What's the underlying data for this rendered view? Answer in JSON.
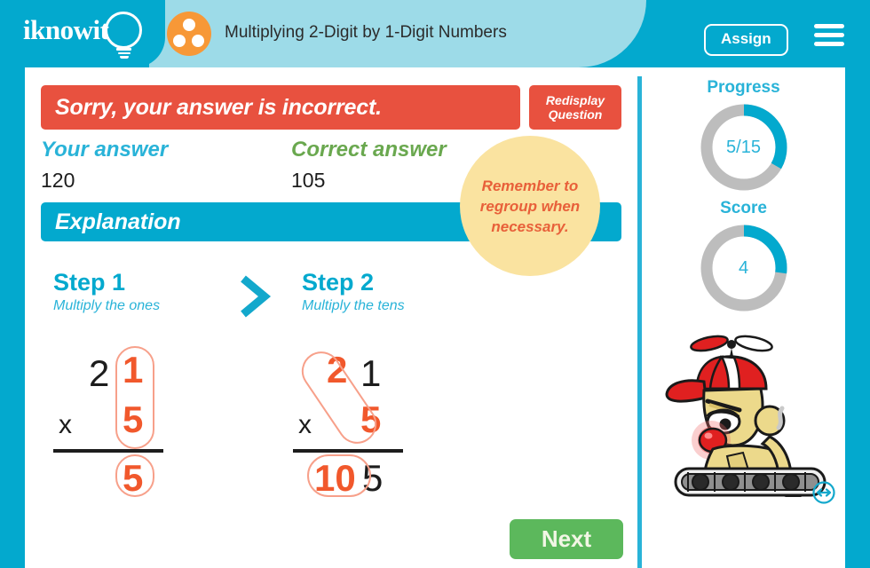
{
  "header": {
    "logo_text": "iknowit",
    "logo_icon": "lightbulb-icon",
    "topic_icon": "three-dots-circle-icon",
    "topic_title": "Multiplying 2-Digit by 1-Digit Numbers",
    "assign_label": "Assign",
    "menu_icon": "hamburger-menu-icon"
  },
  "feedback": {
    "banner_text": "Sorry, your answer is incorrect.",
    "redisplay_line1": "Redisplay",
    "redisplay_line2": "Question",
    "your_answer_label": "Your answer",
    "your_answer_value": "120",
    "correct_answer_label": "Correct answer",
    "correct_answer_value": "105"
  },
  "explanation": {
    "heading": "Explanation",
    "chevron_icon": "chevron-right-icon",
    "steps": [
      {
        "title": "Step 1",
        "subtitle": "Multiply the ones"
      },
      {
        "title": "Step 2",
        "subtitle": "Multiply the tens"
      }
    ],
    "work_step1": {
      "top_tens": "2",
      "top_ones": "1",
      "operator": "x",
      "multiplier": "5",
      "product_ones": "5"
    },
    "work_step2": {
      "top_tens": "2",
      "top_ones": "1",
      "operator": "x",
      "multiplier": "5",
      "product_tens": "10",
      "product_ones": "5"
    },
    "note": "Remember to regroup when necessary."
  },
  "actions": {
    "next_label": "Next"
  },
  "sidebar": {
    "progress_label": "Progress",
    "progress_value": "5/15",
    "score_label": "Score",
    "score_value": "4",
    "mascot_icon": "robot-mascot-icon",
    "resize_icon": "resize-arrows-icon"
  },
  "chart_data": [
    {
      "type": "pie",
      "title": "Progress",
      "categories": [
        "completed",
        "remaining"
      ],
      "values": [
        5,
        10
      ],
      "value_label": "5/15",
      "colors": [
        "#03a9ce",
        "#bdbdbd"
      ]
    },
    {
      "type": "pie",
      "title": "Score",
      "categories": [
        "earned",
        "remaining"
      ],
      "values": [
        27,
        73
      ],
      "value_label": "4",
      "colors": [
        "#03a9ce",
        "#bdbdbd"
      ]
    }
  ],
  "colors": {
    "brand_cyan": "#03a9ce",
    "light_cyan": "#9ddbe8",
    "accent_blue": "#29b3d8",
    "error_red": "#e8513f",
    "correct_green": "#6aa84f",
    "next_green": "#5cb85c",
    "orange": "#f1582c",
    "topic_orange": "#f79837",
    "note_yellow": "#fae3a0",
    "gauge_grey": "#bdbdbd"
  }
}
